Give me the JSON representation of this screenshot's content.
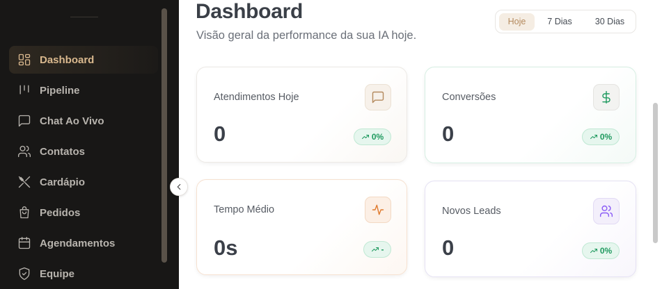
{
  "sidebar": {
    "items": [
      {
        "label": "Dashboard",
        "icon": "dashboard-grid-icon",
        "active": true
      },
      {
        "label": "Pipeline",
        "icon": "pipeline-icon",
        "active": false
      },
      {
        "label": "Chat Ao Vivo",
        "icon": "chat-bubble-icon",
        "active": false
      },
      {
        "label": "Contatos",
        "icon": "users-icon",
        "active": false
      },
      {
        "label": "Cardápio",
        "icon": "utensils-icon",
        "active": false
      },
      {
        "label": "Pedidos",
        "icon": "shopping-bag-icon",
        "active": false
      },
      {
        "label": "Agendamentos",
        "icon": "calendar-icon",
        "active": false
      },
      {
        "label": "Equipe",
        "icon": "shield-icon",
        "active": false
      }
    ]
  },
  "header": {
    "title": "Dashboard",
    "subtitle": "Visão geral da performance da sua IA hoje."
  },
  "period_filter": {
    "options": [
      "Hoje",
      "7 Dias",
      "30 Dias"
    ],
    "selected": "Hoje"
  },
  "cards": [
    {
      "label": "Atendimentos Hoje",
      "value": "0",
      "trend": "0%",
      "icon": "message-square-icon",
      "accent": "#b48a5e"
    },
    {
      "label": "Conversões",
      "value": "0",
      "trend": "0%",
      "icon": "dollar-sign-icon",
      "accent": "#1f9a5f"
    },
    {
      "label": "Tempo Médio",
      "value": "0s",
      "trend": "-",
      "icon": "activity-icon",
      "accent": "#e07a2e"
    },
    {
      "label": "Novos Leads",
      "value": "0",
      "trend": "0%",
      "icon": "users-icon",
      "accent": "#8b5cf6"
    }
  ],
  "colors": {
    "sidebar_bg": "#181716",
    "active_accent": "#d9b88e",
    "trend_green": "#1f9a5f"
  }
}
